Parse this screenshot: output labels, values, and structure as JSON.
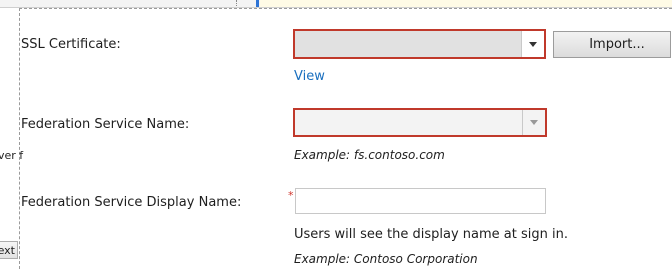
{
  "left_fragment": {
    "text": "ver f",
    "button_text": "ext"
  },
  "ssl_certificate": {
    "label": "SSL Certificate:",
    "value": "",
    "import_label": "Import...",
    "view_link": "View"
  },
  "federation_service_name": {
    "label": "Federation Service Name:",
    "value": "",
    "example": "Example: fs.contoso.com"
  },
  "federation_display_name": {
    "label": "Federation Service Display Name:",
    "required_marker": "*",
    "value": "",
    "helper": "Users will see the display name at sign in.",
    "example": "Example: Contoso Corporation"
  },
  "colors": {
    "error_border": "#c0392b",
    "link": "#1a6fbf",
    "required": "#d0342c"
  },
  "icons": {
    "dropdown": "chevron-down-icon"
  }
}
